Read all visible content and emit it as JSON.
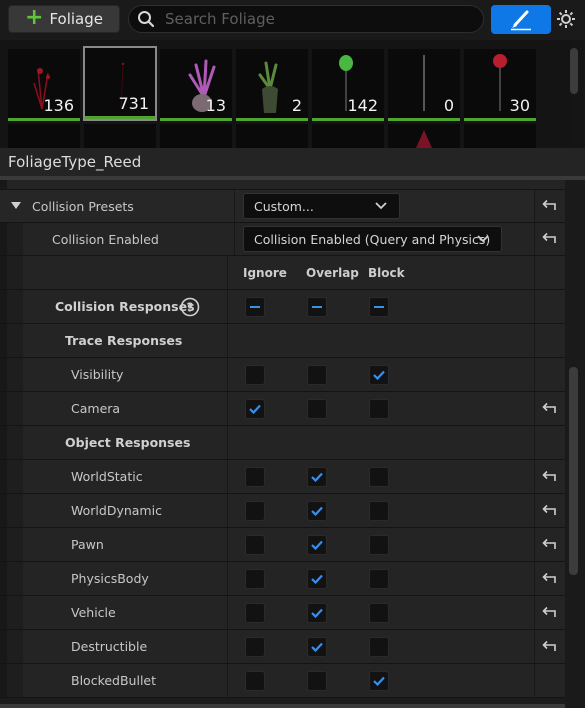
{
  "toolbar": {
    "add_button_label": "Foliage",
    "search_placeholder": "Search Foliage",
    "accent_color": "#0e78e6"
  },
  "thumbnails": [
    {
      "count": "136",
      "icon": "red-shrub"
    },
    {
      "count": "731",
      "icon": "reed",
      "selected": true
    },
    {
      "count": "13",
      "icon": "purple-plant"
    },
    {
      "count": "2",
      "icon": "green-plant"
    },
    {
      "count": "142",
      "icon": "green-balloon"
    },
    {
      "count": "0",
      "icon": "thin-stalk"
    },
    {
      "count": "30",
      "icon": "red-balloon"
    }
  ],
  "details": {
    "title": "FoliageType_Reed"
  },
  "collision": {
    "presets_label": "Collision Presets",
    "presets_value": "Custom...",
    "enabled_label": "Collision Enabled",
    "enabled_value": "Collision Enabled (Query and Physics)",
    "columns": [
      "Ignore",
      "Overlap",
      "Block"
    ],
    "responses_label": "Collision Responses",
    "trace_header": "Trace Responses",
    "object_header": "Object Responses",
    "trace_rows": [
      {
        "label": "Visibility",
        "value": "block",
        "reset": false
      },
      {
        "label": "Camera",
        "value": "ignore",
        "reset": true
      }
    ],
    "object_rows": [
      {
        "label": "WorldStatic",
        "value": "overlap",
        "reset": true
      },
      {
        "label": "WorldDynamic",
        "value": "overlap",
        "reset": true
      },
      {
        "label": "Pawn",
        "value": "overlap",
        "reset": true
      },
      {
        "label": "PhysicsBody",
        "value": "overlap",
        "reset": true
      },
      {
        "label": "Vehicle",
        "value": "overlap",
        "reset": true
      },
      {
        "label": "Destructible",
        "value": "overlap",
        "reset": true
      },
      {
        "label": "BlockedBullet",
        "value": "block",
        "reset": false
      }
    ]
  }
}
